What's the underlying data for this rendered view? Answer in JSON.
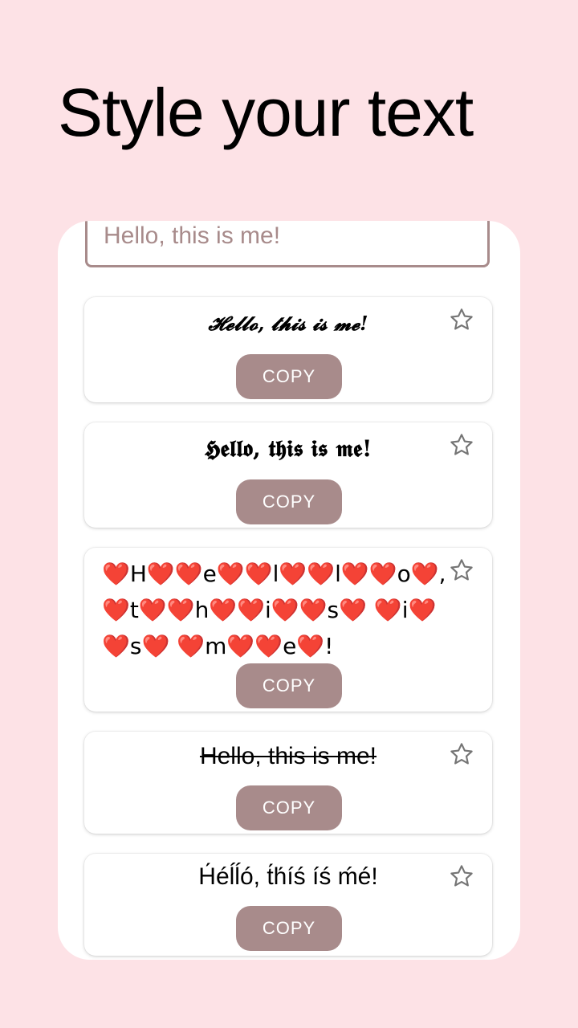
{
  "header": {
    "title": "Style your text"
  },
  "input": {
    "value": "Hello, this is me!"
  },
  "cards": [
    {
      "text": "𝓗𝓮𝓵𝓵𝓸, 𝓽𝓱𝓲𝓼 𝓲𝓼 𝓶𝓮!",
      "copy_label": "COPY",
      "favorite_icon": "star-outline-icon"
    },
    {
      "text": "𝕳𝖊𝖑𝖑𝖔, 𝖙𝖍𝖎𝖘 𝖎𝖘 𝖒𝖊!",
      "copy_label": "COPY",
      "favorite_icon": "star-outline-icon"
    },
    {
      "text": "❤️H❤️❤️e❤️❤️l❤️❤️l❤️❤️o❤️, ❤️t❤️❤️h❤️❤️i❤️❤️s❤️ ❤️i❤️❤️s❤️ ❤️m❤️❤️e❤️!",
      "copy_label": "COPY",
      "favorite_icon": "star-outline-icon"
    },
    {
      "text": "Hello, this is me!",
      "copy_label": "COPY",
      "favorite_icon": "star-outline-icon"
    },
    {
      "text": "H́éĺĺó, t́h́íś íś ḿé!",
      "copy_label": "COPY",
      "favorite_icon": "star-outline-icon"
    }
  ],
  "colors": {
    "background": "#fde2e6",
    "accent": "#a88b8b",
    "panel": "#ffffff"
  }
}
